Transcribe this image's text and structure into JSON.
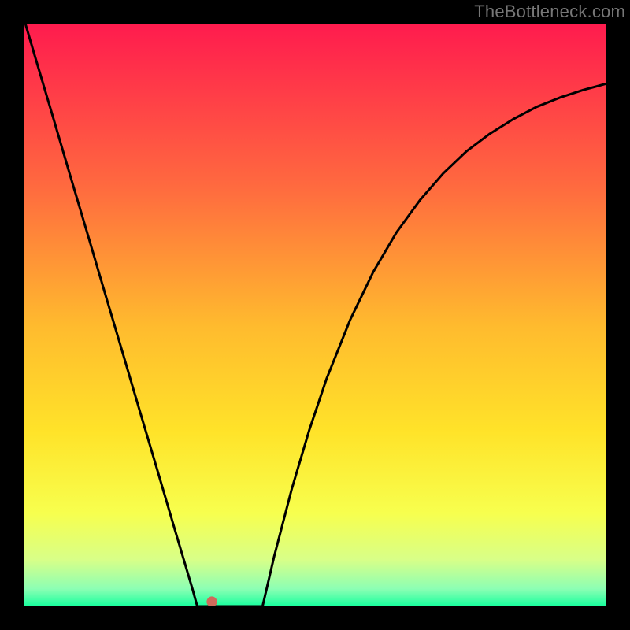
{
  "watermark": "TheBottleneck.com",
  "chart_data": {
    "type": "line",
    "title": "",
    "xlabel": "",
    "ylabel": "",
    "xlim": [
      0,
      100
    ],
    "ylim": [
      0,
      100
    ],
    "grid": false,
    "series": [
      {
        "name": "curve",
        "x": [
          0,
          2,
          5,
          8,
          11,
          14,
          17,
          20,
          23,
          26,
          29,
          29.8,
          30.5,
          31.2,
          31.9,
          32.6,
          33.3,
          34,
          34.7,
          35.4,
          36.1,
          36.8,
          37.5,
          38.2,
          38.9,
          39.6,
          40.3,
          41,
          43,
          46,
          49,
          52,
          56,
          60,
          64,
          68,
          72,
          76,
          80,
          84,
          88,
          92,
          96,
          100
        ],
        "y": [
          101,
          94.2,
          84.1,
          73.9,
          63.8,
          53.6,
          43.5,
          33.3,
          23.2,
          13.0,
          2.9,
          0,
          0,
          0,
          0,
          0,
          0,
          0,
          0,
          0,
          0,
          0,
          0,
          0,
          0,
          0,
          0,
          0,
          8.6,
          20.1,
          30.2,
          39.1,
          49.1,
          57.4,
          64.2,
          69.7,
          74.3,
          78.1,
          81.1,
          83.6,
          85.7,
          87.3,
          88.6,
          89.7
        ]
      }
    ],
    "marker": {
      "x": 32.3,
      "y": 0.8,
      "color": "#cf6a5b",
      "radius_pct": 0.9
    },
    "background": {
      "type": "vertical_gradient",
      "stops": [
        {
          "t": 0.0,
          "color": "#ff1b4e"
        },
        {
          "t": 0.28,
          "color": "#ff6a3f"
        },
        {
          "t": 0.52,
          "color": "#ffbb2e"
        },
        {
          "t": 0.7,
          "color": "#ffe329"
        },
        {
          "t": 0.84,
          "color": "#f7ff4e"
        },
        {
          "t": 0.92,
          "color": "#d8ff88"
        },
        {
          "t": 0.97,
          "color": "#8cffb4"
        },
        {
          "t": 1.0,
          "color": "#17ff9e"
        }
      ]
    }
  }
}
